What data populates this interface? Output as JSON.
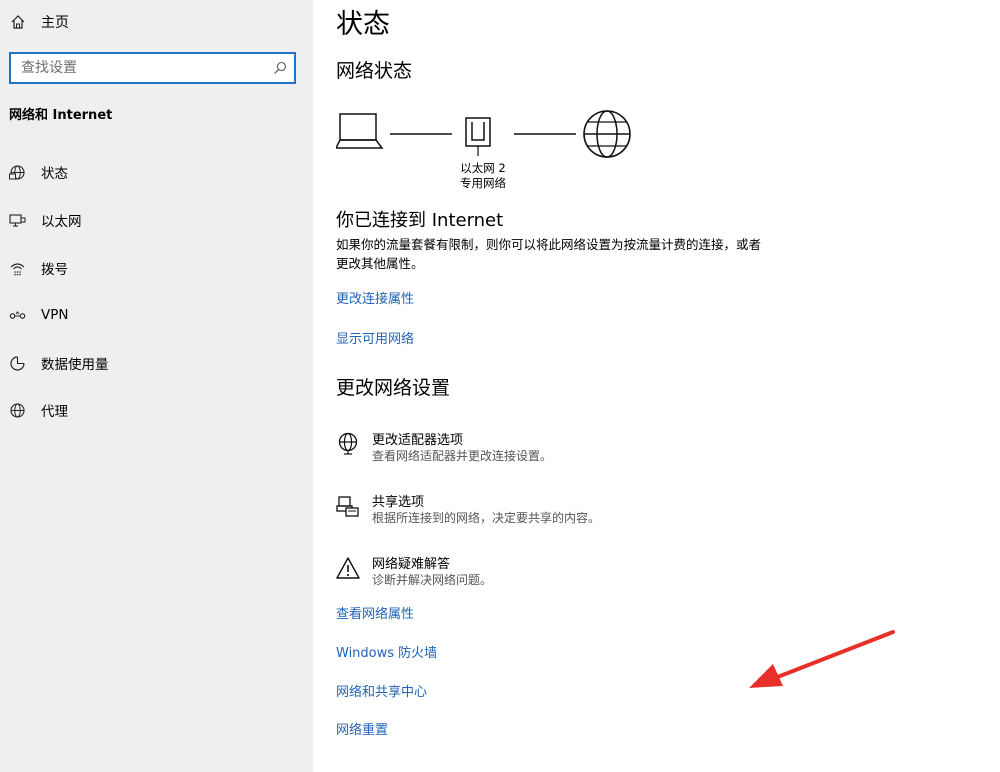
{
  "sidebar": {
    "home_label": "主页",
    "search_placeholder": "查找设置",
    "section_title": "网络和 Internet",
    "items": [
      {
        "label": "状态",
        "icon": "status-globe-icon"
      },
      {
        "label": "以太网",
        "icon": "ethernet-icon"
      },
      {
        "label": "拨号",
        "icon": "dial-up-icon"
      },
      {
        "label": "VPN",
        "icon": "vpn-icon"
      },
      {
        "label": "数据使用量",
        "icon": "data-usage-icon"
      },
      {
        "label": "代理",
        "icon": "proxy-globe-icon"
      }
    ]
  },
  "main": {
    "title": "状态",
    "network_status_heading": "网络状态",
    "adapter_name": "以太网 2",
    "adapter_network": "专用网络",
    "connected_text": "你已连接到 Internet",
    "connected_desc": "如果你的流量套餐有限制，则你可以将此网络设置为按流量计费的连接，或者更改其他属性。",
    "links_top": [
      "更改连接属性",
      "显示可用网络"
    ],
    "change_settings_heading": "更改网络设置",
    "options": [
      {
        "title": "更改适配器选项",
        "sub": "查看网络适配器并更改连接设置。",
        "icon": "adapter-globe-icon"
      },
      {
        "title": "共享选项",
        "sub": "根据所连接到的网络，决定要共享的内容。",
        "icon": "sharing-icon"
      },
      {
        "title": "网络疑难解答",
        "sub": "诊断并解决网络问题。",
        "icon": "warning-icon"
      }
    ],
    "links_bottom": [
      "查看网络属性",
      "Windows 防火墙",
      "网络和共享中心",
      "网络重置"
    ]
  },
  "colors": {
    "sidebar_bg": "#eef0f0",
    "link": "#1f63b5",
    "search_border": "#1f74c8",
    "annotation_arrow": "#e8302a"
  }
}
